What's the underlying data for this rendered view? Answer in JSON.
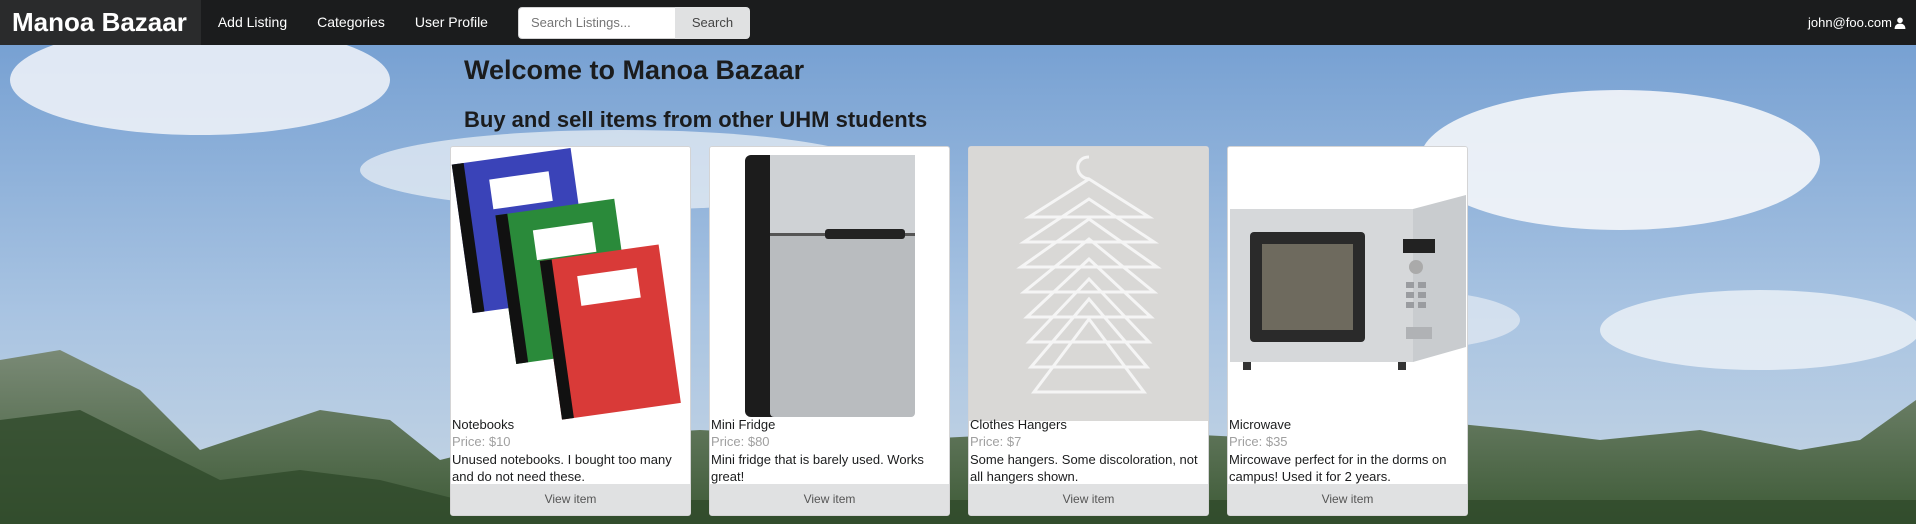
{
  "nav": {
    "brand": "Manoa Bazaar",
    "items": [
      "Add Listing",
      "Categories",
      "User Profile"
    ],
    "search_placeholder": "Search Listings...",
    "search_button": "Search",
    "user": "john@foo.com"
  },
  "main": {
    "title": "Welcome to Manoa Bazaar",
    "subtitle": "Buy and sell items from other UHM students",
    "listings": [
      {
        "name": "Notebooks",
        "price": "Price: $10",
        "description": "Unused notebooks. I bought too many and do not need these.",
        "action": "View item"
      },
      {
        "name": "Mini Fridge",
        "price": "Price: $80",
        "description": "Mini fridge that is barely used. Works great!",
        "action": "View item"
      },
      {
        "name": "Clothes Hangers",
        "price": "Price: $7",
        "description": "Some hangers. Some discoloration, not all hangers shown.",
        "action": "View item"
      },
      {
        "name": "Microwave",
        "price": "Price: $35",
        "description": "Mircowave perfect for in the dorms on campus! Used it for 2 years.",
        "action": "View item"
      }
    ]
  },
  "colors": {
    "navbar": "#1b1c1d",
    "button": "#e0e1e2",
    "price": "#a0a0a0"
  }
}
